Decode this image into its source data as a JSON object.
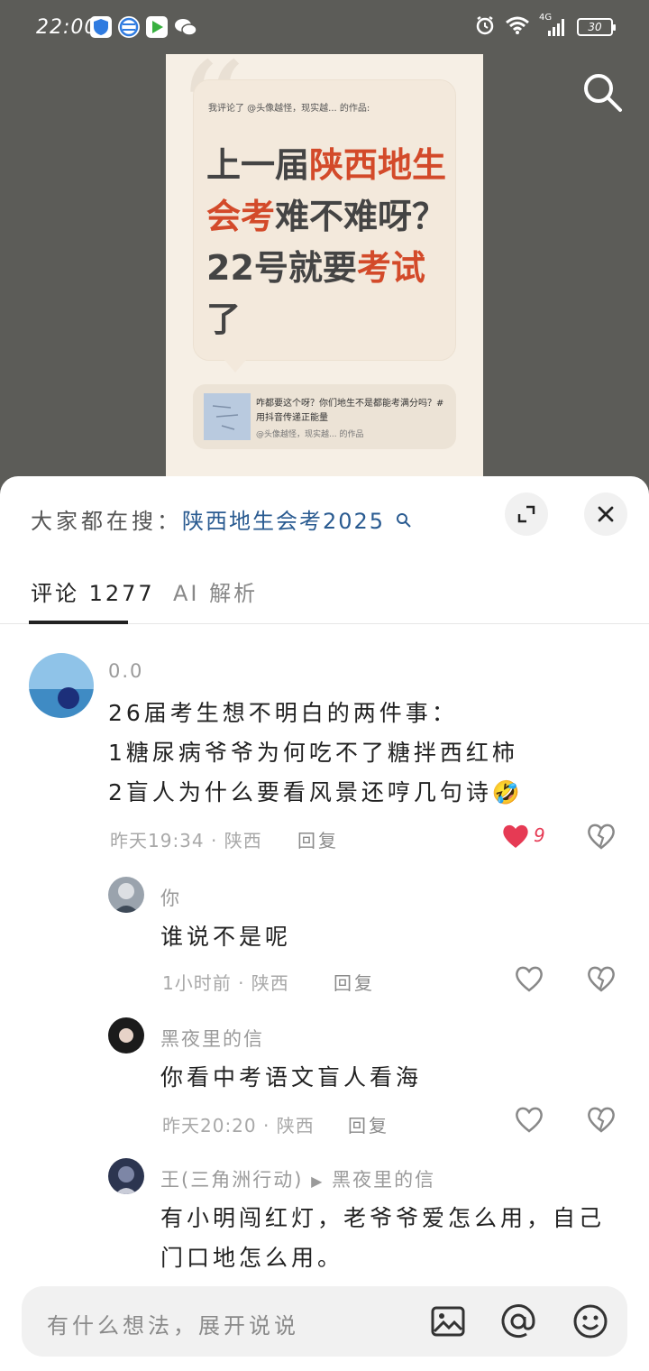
{
  "status_bar": {
    "time": "22:00",
    "network": "4G",
    "battery": "30"
  },
  "preview": {
    "header": "我评论了 @头像越怪，现实越... 的作品:",
    "headline_plain_1": "上一届",
    "headline_hl_1": "陕西地生会考",
    "headline_plain_2": "难不难呀？22号就要",
    "headline_hl_2": "考试",
    "headline_plain_3": "了",
    "repost_text": "咋都要这个呀？你们地生不是都能考满分吗？#用抖音传递正能量",
    "repost_author": "@头像越怪，现实越... 的作品"
  },
  "sheet": {
    "hot_label": "大家都在搜：",
    "hot_keyword": "陕西地生会考2025",
    "tabs": [
      {
        "label": "评论 1277"
      },
      {
        "label": "AI 解析"
      }
    ]
  },
  "comments": [
    {
      "user": "0.0",
      "lines": [
        "26届考生想不明白的两件事：",
        "1糖尿病爷爷为何吃不了糖拌西红柿",
        "2盲人为什么要看风景还哼几句诗🤣"
      ],
      "meta": "昨天19:34 · 陕西",
      "reply_label": "回复",
      "likes": "9",
      "liked": true
    },
    {
      "user": "你",
      "lines": [
        "谁说不是呢"
      ],
      "meta": "1小时前 · 陕西",
      "reply_label": "回复"
    },
    {
      "user": "黑夜里的信",
      "lines": [
        "你看中考语文盲人看海"
      ],
      "meta": "昨天20:20 · 陕西",
      "reply_label": "回复"
    },
    {
      "user": "王(三角洲行动)",
      "reply_to": "黑夜里的信",
      "lines": [
        "有小明闯红灯，老爷爷爱怎么用，自己",
        "门口地怎么用。"
      ]
    }
  ],
  "input": {
    "placeholder": "有什么想法，展开说说"
  },
  "colors": {
    "accent_red": "#d34a2a",
    "like_red": "#e63a54",
    "link_blue": "#2a5b91"
  }
}
